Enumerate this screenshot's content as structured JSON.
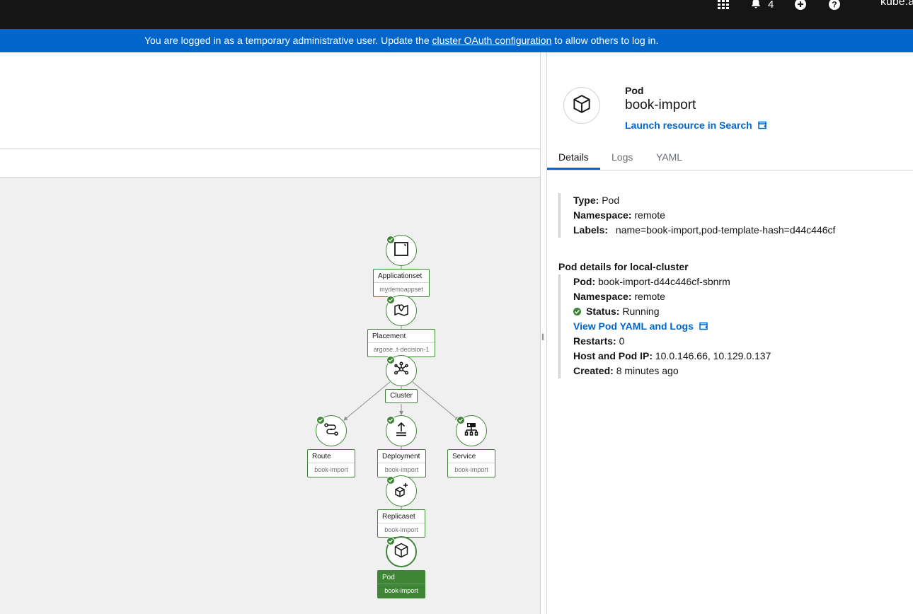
{
  "masthead": {
    "notifications_count": "4",
    "user_label": "kube:a",
    "icons": [
      "grid-icon",
      "bell-icon",
      "plus-circle-icon",
      "question-circle-icon"
    ]
  },
  "banner": {
    "text_before": "You are logged in as a temporary administrative user. Update the",
    "link_text": "cluster OAuth configuration",
    "text_after": "to allow others to log in."
  },
  "topology": {
    "nodes": [
      {
        "kind": "Applicationset",
        "name": "mydemoappset",
        "icon": "square-icon",
        "status": "ok"
      },
      {
        "kind": "Placement",
        "name": "argose..t-decision-1",
        "icon": "map-pin-icon",
        "status": "ok"
      },
      {
        "kind": "Cluster",
        "name": "",
        "icon": "cluster-icon",
        "status": "ok"
      },
      {
        "kind": "Route",
        "name": "book-import",
        "icon": "route-icon",
        "status": "ok"
      },
      {
        "kind": "Deployment",
        "name": "book-import",
        "icon": "deploy-icon",
        "status": "ok"
      },
      {
        "kind": "Service",
        "name": "book-import",
        "icon": "service-icon",
        "status": "ok"
      },
      {
        "kind": "Replicaset",
        "name": "book-import",
        "icon": "replicaset-icon",
        "status": "ok"
      },
      {
        "kind": "Pod",
        "name": "book-import",
        "icon": "cube-icon",
        "status": "ok",
        "selected": true
      }
    ]
  },
  "panel": {
    "kind": "Pod",
    "name": "book-import",
    "launch_link": "Launch resource in Search",
    "tabs": [
      "Details",
      "Logs",
      "YAML"
    ],
    "active_tab": "Details",
    "summary": {
      "type_label": "Type:",
      "type_value": "Pod",
      "namespace_label": "Namespace:",
      "namespace_value": "remote",
      "labels_label": "Labels:",
      "labels_value": "name=book-import,pod-template-hash=d44c446cf"
    },
    "cluster_section_title": "Pod details for local-cluster",
    "details": {
      "pod_label": "Pod:",
      "pod_value": "book-import-d44c446cf-sbnrm",
      "namespace_label": "Namespace:",
      "namespace_value": "remote",
      "status_label": "Status:",
      "status_value": "Running",
      "yaml_logs_link": "View Pod YAML and Logs",
      "restarts_label": "Restarts:",
      "restarts_value": "0",
      "ip_label": "Host and Pod IP:",
      "ip_value": "10.0.146.66, 10.129.0.137",
      "created_label": "Created:",
      "created_value": "8 minutes ago"
    }
  },
  "colors": {
    "masthead": "#151515",
    "banner": "#0066cc",
    "status_ok": "#3e8635",
    "link": "#0066cc",
    "canvas": "#f0f0f0"
  }
}
